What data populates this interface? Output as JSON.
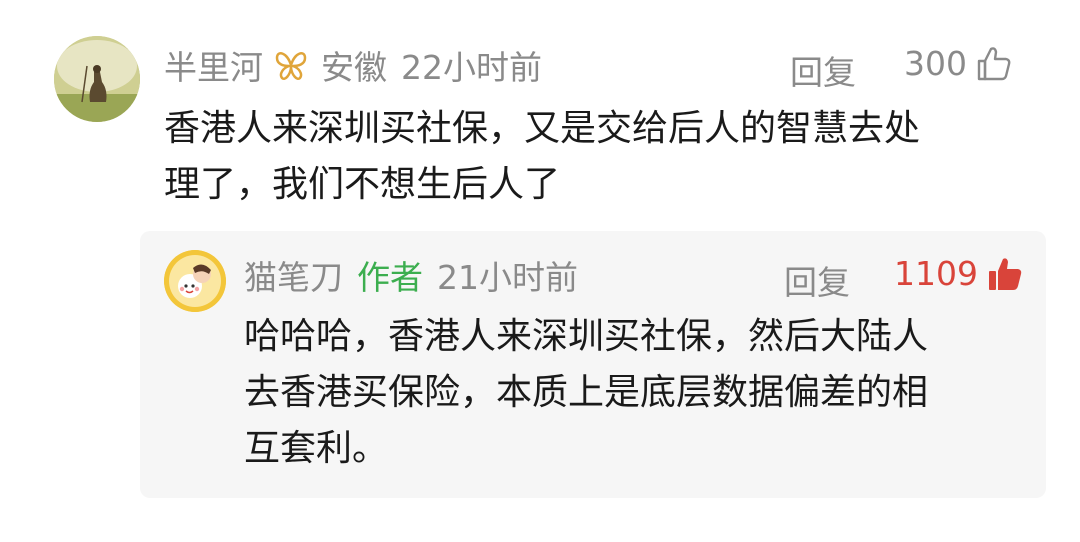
{
  "comment": {
    "username": "半里河",
    "location": "安徽",
    "time": "22小时前",
    "reply_label": "回复",
    "like_count": "300",
    "text": "香港人来深圳买社保，又是交给后人的智慧去处理了，我们不想生后人了",
    "text_lines": [
      "香港人来深圳买社保，又是交给后人的智慧去处",
      "理了，我们不想生后人了"
    ],
    "badge_icon": "butterfly-badge-icon",
    "like_icon": "thumbs-up-outline-icon"
  },
  "reply": {
    "username": "猫笔刀",
    "author_tag": "作者",
    "time": "21小时前",
    "reply_label": "回复",
    "like_count": "1109",
    "text_lines": [
      "哈哈哈，香港人来深圳买社保，然后大陆人",
      "去香港买保险，本质上是底层数据偏差的相",
      "互套利。"
    ],
    "like_icon": "thumbs-up-filled-icon"
  },
  "colors": {
    "meta_gray": "#8a8a8a",
    "author_green": "#3cae4f",
    "liked_red": "#d9443a",
    "reply_bg": "#f6f6f6",
    "badge_gold": "#e0a53a"
  }
}
